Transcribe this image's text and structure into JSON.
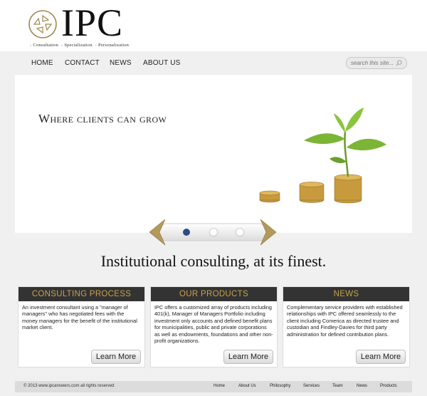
{
  "logo": {
    "text": "IPC",
    "tagline": [
      "Consultation",
      "Specialization",
      "Personalization"
    ]
  },
  "nav": {
    "items": [
      "HOME",
      "CONTACT",
      "NEWS",
      "ABOUT US"
    ]
  },
  "search": {
    "placeholder": "search this site..."
  },
  "slider": {
    "heading": "Where clients can grow",
    "dots": 3,
    "active_dot": 1
  },
  "tagline": "Institutional consulting, at its finest.",
  "boxes": [
    {
      "title": "CONSULTING PROCESS",
      "body": "An investment consultant using a \"manager of managers\" who has negotiated fees with the money managers for the benefit of the institutional market client.",
      "button": "Learn More"
    },
    {
      "title": "OUR PRODUCTS",
      "body": "IPC offers a customized array of products including 401(k), Manager of Managers Portfolio including investment only accounts and defined benefit plans for municipalities, public and private corporations as well as endowments, foundations and other non-profit organizations.",
      "button": "Learn More"
    },
    {
      "title": "NEWS",
      "body": "Complementary service providers with established relationships with IPC offered seamlessly to the client including Comerica as directed trustee and custodian and Findley-Davies for third party administration for defined contribution plans.",
      "button": "Learn More"
    }
  ],
  "footer": {
    "copyright": "© 2013 www.ipcanswers.com all rights reserved",
    "links": [
      "Home",
      "About Us",
      "Philosophy",
      "Services",
      "Team",
      "News",
      "Products"
    ]
  },
  "colors": {
    "accent_gold": "#c9a24a",
    "header_dark": "#333333",
    "active_dot": "#2f4a8c"
  }
}
